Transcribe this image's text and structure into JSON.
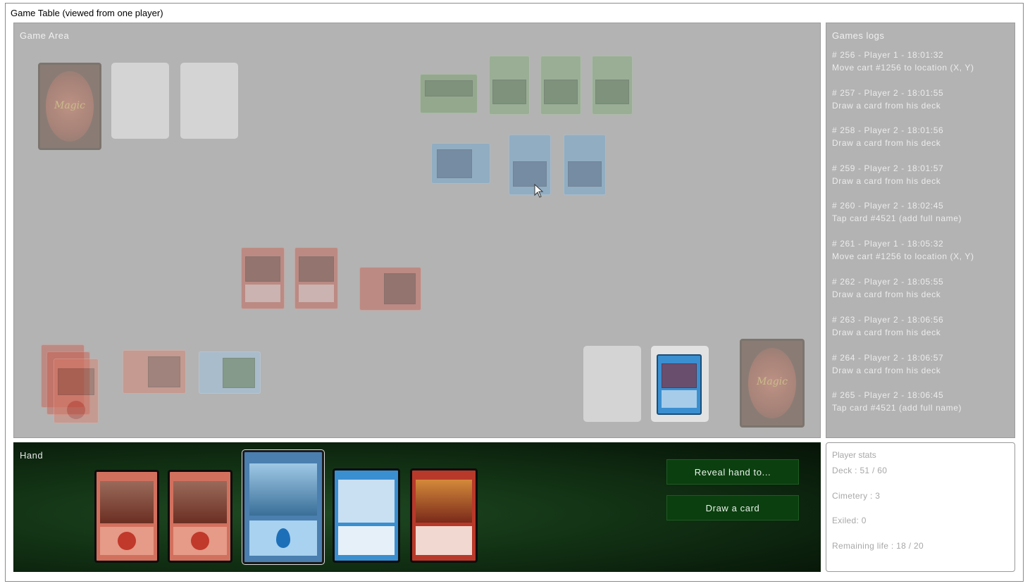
{
  "window": {
    "title": "Game Table (viewed from one player)"
  },
  "game_area": {
    "label": "Game Area"
  },
  "logs": {
    "label": "Games logs",
    "entries": [
      {
        "header": "# 256 - Player 1 - 18:01:32",
        "action": "Move cart #1256 to location (X, Y)"
      },
      {
        "header": "# 257 - Player 2 - 18:01:55",
        "action": "Draw a card from his deck"
      },
      {
        "header": "# 258 - Player 2 - 18:01:56",
        "action": "Draw a card from his deck"
      },
      {
        "header": "# 259 - Player 2 - 18:01:57",
        "action": "Draw a card from his deck"
      },
      {
        "header": "# 260 - Player 2 - 18:02:45",
        "action": "Tap card #4521 (add full name)"
      },
      {
        "header": "# 261 - Player 1 - 18:05:32",
        "action": "Move cart #1256 to location (X, Y)"
      },
      {
        "header": "# 262 - Player 2 - 18:05:55",
        "action": "Draw a card from his deck"
      },
      {
        "header": "# 263 - Player 2 - 18:06:56",
        "action": "Draw a card from his deck"
      },
      {
        "header": "# 264 - Player 2 - 18:06:57",
        "action": "Draw a card from his deck"
      },
      {
        "header": "# 265 - Player 2 - 18:06:45",
        "action": "Tap card #4521 (add full name)"
      }
    ]
  },
  "hand": {
    "label": "Hand",
    "reveal_button": "Reveal hand to...",
    "draw_button": "Draw a card"
  },
  "stats": {
    "title": "Player stats",
    "deck": "Deck : 51 / 60",
    "cimetery": "Cimetery : 3",
    "exiled": "Exiled: 0",
    "life": "Remaining life : 18 / 20"
  },
  "colors": {
    "game_area_bg": "#b3b3b3",
    "hand_bg": "#123214",
    "button_bg": "#0b3f0f",
    "mountain_red": "#c0392b",
    "island_blue": "#3a8fd0"
  }
}
